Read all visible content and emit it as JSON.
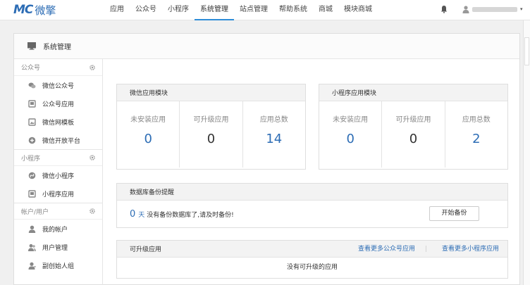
{
  "header": {
    "logo_mark": "MC",
    "logo_text": "微擎",
    "nav": [
      "应用",
      "公众号",
      "小程序",
      "系统管理",
      "站点管理",
      "帮助系统",
      "商城",
      "模块商城"
    ],
    "active_nav": "系统管理",
    "user_caret": "▾"
  },
  "panel": {
    "title": "系统管理"
  },
  "sidebar": {
    "sections": [
      {
        "title": "公众号",
        "items": [
          "微信公众号",
          "公众号应用",
          "微信网模板",
          "微信开放平台"
        ]
      },
      {
        "title": "小程序",
        "items": [
          "微信小程序",
          "小程序应用"
        ]
      },
      {
        "title": "帐户/用户",
        "items": [
          "我的帐户",
          "用户管理",
          "副创始人组"
        ]
      }
    ]
  },
  "wechat_modules": {
    "title": "微信应用模块",
    "stats": [
      {
        "label": "未安装应用",
        "value": "0",
        "color": "#2d6db5"
      },
      {
        "label": "可升级应用",
        "value": "0",
        "color": "#333333"
      },
      {
        "label": "应用总数",
        "value": "14",
        "color": "#2d6db5"
      }
    ]
  },
  "miniapp_modules": {
    "title": "小程序应用模块",
    "stats": [
      {
        "label": "未安装应用",
        "value": "0",
        "color": "#2d6db5"
      },
      {
        "label": "可升级应用",
        "value": "0",
        "color": "#333333"
      },
      {
        "label": "应用总数",
        "value": "2",
        "color": "#2d6db5"
      }
    ]
  },
  "backup": {
    "title": "数据库备份提醒",
    "days": "0",
    "unit": "天",
    "message": "没有备份数据库了,请及时备份!",
    "button": "开始备份"
  },
  "upgradable": {
    "title": "可升级应用",
    "link_wechat": "查看更多公众号应用",
    "separator": "|",
    "link_miniapp": "查看更多小程序应用",
    "empty": "没有可升级的应用"
  },
  "colors": {
    "accent": "#2d6db5",
    "nav_active": "#2d8cd8"
  }
}
